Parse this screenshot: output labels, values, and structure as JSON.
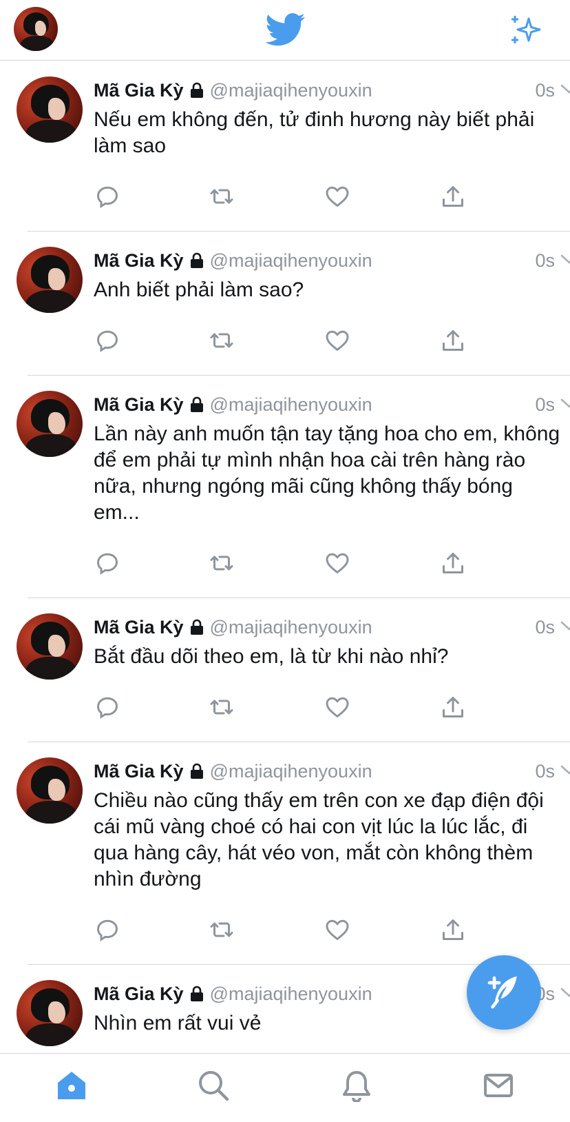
{
  "colors": {
    "accent": "#4a9ded",
    "text": "#14171a",
    "muted": "#8e959c",
    "divider": "#d2d6da"
  },
  "header": {
    "logo_icon": "twitter-bird-icon",
    "right_icon": "sparkle-icon",
    "left_icon": "profile-avatar"
  },
  "tweets": [
    {
      "name": "Mã Gia Kỳ",
      "handle": "@majiaqihenyouxin",
      "time": "0s",
      "text": "Nếu em không đến, tử đinh hương này biết phải làm sao"
    },
    {
      "name": "Mã Gia Kỳ",
      "handle": "@majiaqihenyouxin",
      "time": "0s",
      "text": "Anh biết phải làm sao?"
    },
    {
      "name": "Mã Gia Kỳ",
      "handle": "@majiaqihenyouxin",
      "time": "0s",
      "text": "Lần này anh muốn tận tay tặng hoa cho em, không để em phải tự mình nhận hoa cài trên hàng rào nữa, nhưng ngóng mãi cũng không thấy bóng em..."
    },
    {
      "name": "Mã Gia Kỳ",
      "handle": "@majiaqihenyouxin",
      "time": "0s",
      "text": "Bắt đầu dõi theo em, là từ khi nào nhỉ?"
    },
    {
      "name": "Mã Gia Kỳ",
      "handle": "@majiaqihenyouxin",
      "time": "0s",
      "text": "Chiều nào cũng thấy em trên con xe đạp điện đội cái mũ vàng choé có hai con vịt lúc la lúc lắc, đi qua hàng cây, hát véo von, mắt còn không thèm nhìn đường"
    },
    {
      "name": "Mã Gia Kỳ",
      "handle": "@majiaqihenyouxin",
      "time": "0s",
      "text": "Nhìn em rất vui vẻ"
    }
  ],
  "action_icons": [
    "reply-icon",
    "retweet-icon",
    "like-icon",
    "share-icon"
  ],
  "fab": {
    "icon": "compose-icon"
  },
  "tabbar": {
    "items": [
      "home-icon",
      "search-icon",
      "notifications-icon",
      "messages-icon"
    ],
    "active": "home-icon"
  }
}
